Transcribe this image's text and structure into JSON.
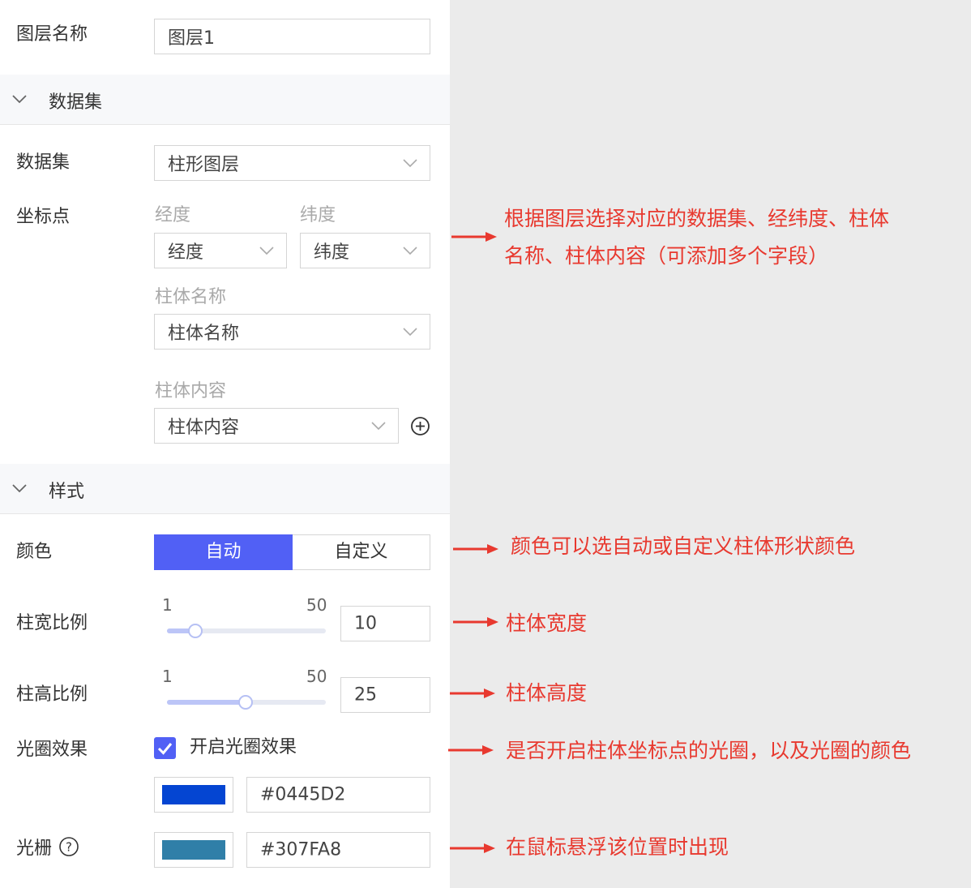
{
  "layer_name": {
    "label": "图层名称",
    "value": "图层1"
  },
  "dataset_section": {
    "title": "数据集"
  },
  "dataset": {
    "label": "数据集",
    "value": "柱形图层"
  },
  "coords": {
    "label": "坐标点",
    "longitude": {
      "label": "经度",
      "value": "经度"
    },
    "latitude": {
      "label": "纬度",
      "value": "纬度"
    },
    "bar_name": {
      "label": "柱体名称",
      "value": "柱体名称"
    },
    "bar_content": {
      "label": "柱体内容",
      "value": "柱体内容"
    }
  },
  "style_section": {
    "title": "样式"
  },
  "color": {
    "label": "颜色",
    "options": [
      "自动",
      "自定义"
    ],
    "selected": "自动"
  },
  "bar_width": {
    "label": "柱宽比例",
    "min": "1",
    "max": "50",
    "value": "10"
  },
  "bar_height": {
    "label": "柱高比例",
    "min": "1",
    "max": "50",
    "value": "25"
  },
  "halo": {
    "label": "光圈效果",
    "checkbox_label": "开启光圈效果",
    "checked": true,
    "color": "#0445D2"
  },
  "grating": {
    "label": "光栅",
    "color": "#307FA8"
  },
  "annotations": {
    "dataset_note_line1": "根据图层选择对应的数据集、经纬度、柱体",
    "dataset_note_line2": "名称、柱体内容（可添加多个字段）",
    "color_note": "颜色可以选自动或自定义柱体形状颜色",
    "width_note": "柱体宽度",
    "height_note": "柱体高度",
    "halo_note": "是否开启柱体坐标点的光圈，以及光圈的颜色",
    "grating_note": "在鼠标悬浮该位置时出现"
  },
  "colors": {
    "accent": "#5160f5",
    "annotation": "#e8392f"
  }
}
